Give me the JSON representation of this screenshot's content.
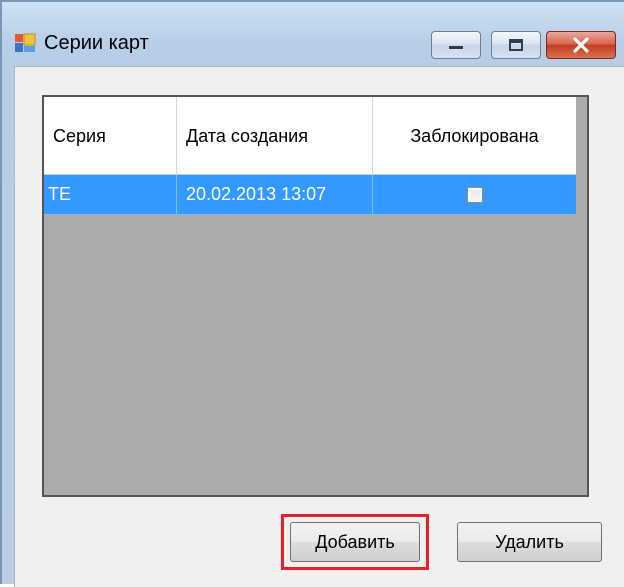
{
  "window": {
    "title": "Серии карт"
  },
  "grid": {
    "columns": [
      "Серия",
      "Дата создания",
      "Заблокирована"
    ],
    "rows": [
      {
        "series": "TE",
        "created": "20.02.2013 13:07",
        "blocked": false,
        "selected": true
      }
    ]
  },
  "buttons": {
    "add_label": "Добавить",
    "delete_label": "Удалить"
  },
  "colors": {
    "selection": "#3399ff",
    "grid_background": "#ababab",
    "highlight": "#e8202a"
  },
  "icons": {
    "app": "app-window-icon",
    "minimize": "minimize-icon",
    "maximize": "maximize-icon",
    "close": "close-icon"
  }
}
